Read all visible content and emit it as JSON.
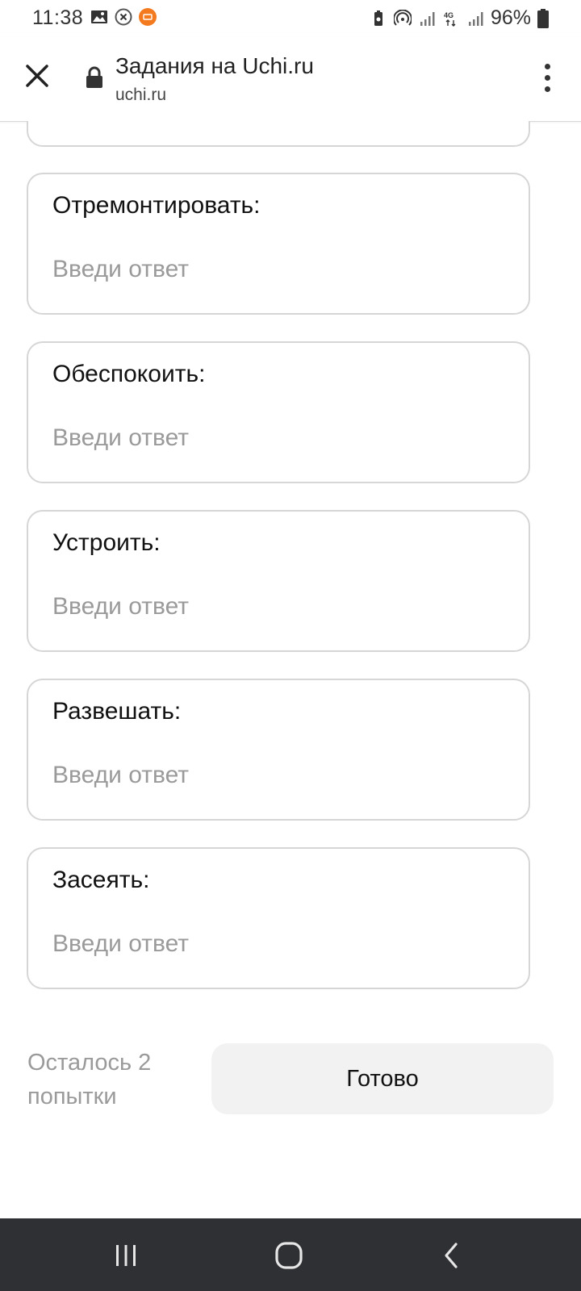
{
  "status_bar": {
    "time": "11:38",
    "left_icons": [
      "image-icon",
      "x-circle-icon",
      "mi-icon"
    ],
    "right_icons": [
      "battery-saver-icon",
      "hotspot-icon",
      "signal-icon",
      "4g-icon",
      "signal-icon-2"
    ],
    "battery": "96%"
  },
  "browser": {
    "title": "Задания на Uchi.ru",
    "url": "uchi.ru",
    "close_icon": "close-icon",
    "lock_icon": "lock-icon",
    "menu_icon": "more-vert-icon"
  },
  "form": {
    "fields": [
      {
        "label": "Отремонтировать:",
        "placeholder": "Введи ответ",
        "value": ""
      },
      {
        "label": "Обеспокоить:",
        "placeholder": "Введи ответ",
        "value": ""
      },
      {
        "label": "Устроить:",
        "placeholder": "Введи ответ",
        "value": ""
      },
      {
        "label": "Развешать:",
        "placeholder": "Введи ответ",
        "value": ""
      },
      {
        "label": "Засеять:",
        "placeholder": "Введи ответ",
        "value": ""
      }
    ],
    "attempts_text": "Осталось 2 попытки",
    "done_label": "Готово"
  },
  "colors": {
    "nav_bar": "#2f3034",
    "card_border": "#d6d6d6",
    "placeholder": "#9a9a9a",
    "button_bg": "#f2f2f2"
  },
  "nav": {
    "icons": [
      "recent-apps-icon",
      "home-icon",
      "back-icon"
    ]
  }
}
